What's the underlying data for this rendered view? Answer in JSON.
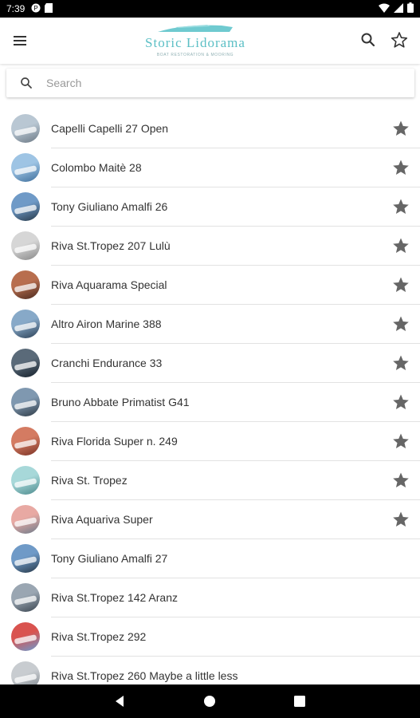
{
  "status": {
    "time": "7:39"
  },
  "header": {
    "logo_title": "Storic Lidorama",
    "logo_subtitle": "BOAT RESTORATION & MOORING",
    "icons": [
      "menu-icon",
      "search-icon",
      "star-outline-icon"
    ]
  },
  "search": {
    "placeholder": "Search"
  },
  "boats": [
    {
      "name": "Capelli Capelli 27 Open",
      "favorite": true,
      "thumb": [
        "#b9c7d3",
        "#6d7a86"
      ]
    },
    {
      "name": "Colombo Maitè 28",
      "favorite": true,
      "thumb": [
        "#9ec4e4",
        "#3f6f9c"
      ]
    },
    {
      "name": "Tony Giuliano Amalfi 26",
      "favorite": true,
      "thumb": [
        "#6f9ac7",
        "#263848"
      ]
    },
    {
      "name": "Riva St.Tropez 207 Lulù",
      "favorite": true,
      "thumb": [
        "#d6d6d6",
        "#888888"
      ]
    },
    {
      "name": "Riva Aquarama Special",
      "favorite": true,
      "thumb": [
        "#b86e4e",
        "#4b2a1f"
      ]
    },
    {
      "name": "Altro Airon Marine 388",
      "favorite": true,
      "thumb": [
        "#87a9c8",
        "#2b3f55"
      ]
    },
    {
      "name": "Cranchi Endurance 33",
      "favorite": true,
      "thumb": [
        "#5a6a79",
        "#15202b"
      ]
    },
    {
      "name": "Bruno Abbate Primatist G41",
      "favorite": true,
      "thumb": [
        "#7f98b0",
        "#2f3b46"
      ]
    },
    {
      "name": "Riva Florida Super n. 249",
      "favorite": true,
      "thumb": [
        "#d47b62",
        "#7c3325"
      ]
    },
    {
      "name": "Riva St. Tropez",
      "favorite": true,
      "thumb": [
        "#a7d8d9",
        "#4f8c8f"
      ]
    },
    {
      "name": "Riva Aquariva Super",
      "favorite": true,
      "thumb": [
        "#e8a9a3",
        "#6e7c8b"
      ]
    },
    {
      "name": "Tony Giuliano Amalfi 27",
      "favorite": false,
      "thumb": [
        "#6f9ac7",
        "#263848"
      ]
    },
    {
      "name": "Riva St.Tropez 142 Aranz",
      "favorite": false,
      "thumb": [
        "#9aa6b2",
        "#3a4550"
      ]
    },
    {
      "name": "Riva St.Tropez 292",
      "favorite": false,
      "thumb": [
        "#d9534f",
        "#6a9bd0"
      ]
    },
    {
      "name": "Riva St.Tropez 260 Maybe a little less",
      "favorite": false,
      "thumb": [
        "#c8ccd0",
        "#7d858c"
      ]
    }
  ],
  "colors": {
    "accent": "#5bbfc5",
    "star": "#666666"
  },
  "navbar": {
    "icons": [
      "back-icon",
      "home-icon",
      "recents-icon"
    ]
  }
}
